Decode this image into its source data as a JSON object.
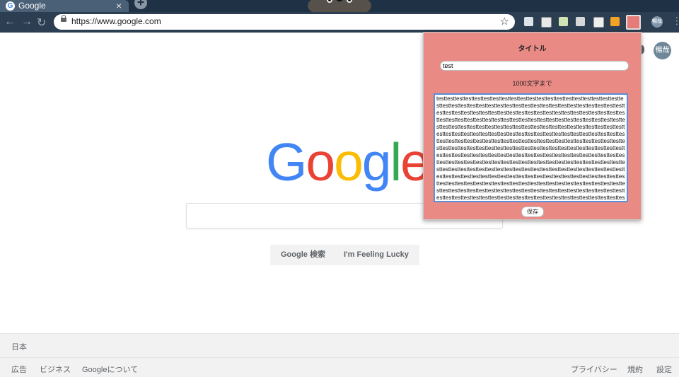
{
  "browser": {
    "tab": {
      "title": "Google",
      "favicon": "google-g-icon"
    },
    "newtab_label": "+",
    "url": "https://www.google.com",
    "profile_label": "暢哉",
    "extensions": [
      "comment-icon",
      "puzzle-icon",
      "leaf-icon",
      "badge-icon",
      "diamond-icon",
      "orange-icon",
      "red-note-icon"
    ]
  },
  "page": {
    "logo": "Google",
    "logo_colors": [
      "#4285F4",
      "#EA4335",
      "#FBBC05",
      "#4285F4",
      "#34A853",
      "#EA4335"
    ],
    "search_button": "Google 検索",
    "lucky_button": "I'm Feeling Lucky",
    "avatar_label": "暢哉",
    "footer": {
      "country": "日本",
      "left_links": [
        "広告",
        "ビジネス",
        "Googleについて"
      ],
      "right_links": [
        "プライバシー",
        "規約",
        "設定"
      ]
    }
  },
  "popup": {
    "title": "タイトル",
    "title_value": "test",
    "limit_label": "1000文字まで",
    "body_value": "testtesttesttesttesttesttesttesttesttesttesttesttesttesttesttesttesttesttesttesttesttesttesttesttesttesttesttesttesttesttesttesttesttesttesttesttesttesttesttesttesttesttesttesttesttesttesttesttesttesttesttesttesttesttesttesttesttesttesttesttesttesttesttesttesttesttesttesttesttesttesttesttesttesttesttesttesttesttesttesttesttesttesttesttesttesttesttesttesttesttesttesttesttesttesttesttesttesttesttesttesttesttesttesttesttesttesttesttesttesttesttesttesttesttesttesttesttesttesttesttesttesttesttesttesttesttesttesttesttesttesttesttesttesttesttesttesttesttesttesttesttesttesttesttesttesttesttesttesttesttesttesttesttesttesttesttesttesttesttesttesttesttesttesttesttesttesttesttesttesttesttesttesttesttesttesttesttesttesttesttesttesttesttesttesttesttesttesttesttesttesttesttesttesttesttesttesttesttesttesttesttesttesttesttesttesttesttesttesttesttesttesttesttesttesttesttesttesttesttesttesttesttesttesttesttesttesttesttesttesttesttesttesttesttesttesttesttesttesttesttesttesttesttesttesttesttesttesttesttesttesttesttesttesttesttesttesttesttesttesttesttesttesttesttesttesttesttesttesttesttesttesttesttesttesttesttesttesttesttesttesttesttesttesttesttesttesttesttesttesttesttesttesttesttesttesttesttesttesttesttesttesttesttesttesttesttesttesttesttesttesttesttesttesttesttesttesttesttesttesttesttesttesttesttesttesttesttesttesttesttesttesttesttesttesttesttesttesttesttesttesttesttesttesttesttesttesttesttesttesttesttesttesttesttesttesttesttesttesttesttesttesttesttesttesttesttesttesttesttesttesttesttesttesttesttesttesttesttesttesttesttesttesttesttesttesttesttesttesttesttesttesttesttesttesttesttesttesttesttesttesttesttesttesttesttesttesttesttesttesttesttesttesttesttesttesttesttesttesttesttesttesttesttesttesttesttest",
    "save_label": "保存",
    "background_color": "#EA8A85"
  }
}
